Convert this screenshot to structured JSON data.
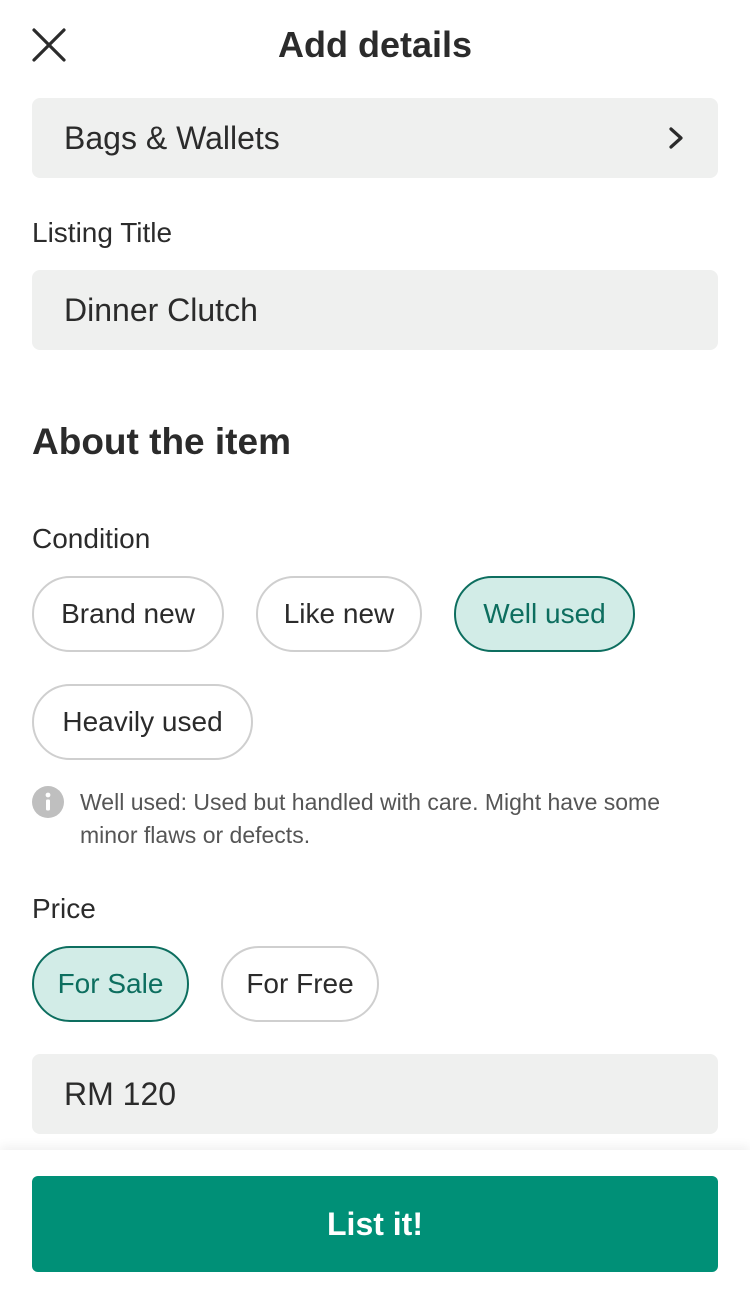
{
  "header": {
    "title": "Add details",
    "close_icon": "close-icon"
  },
  "category": {
    "value": "Bags & Wallets",
    "icon": "chevron-right-icon"
  },
  "listing_title": {
    "label": "Listing Title",
    "value": "Dinner Clutch"
  },
  "about": {
    "title": "About the item"
  },
  "condition": {
    "label": "Condition",
    "options": [
      {
        "label": "Brand new",
        "selected": false
      },
      {
        "label": "Like new",
        "selected": false
      },
      {
        "label": "Well used",
        "selected": true
      },
      {
        "label": "Heavily used",
        "selected": false
      }
    ],
    "hint": "Well used: Used but handled with care. Might have some minor flaws or defects.",
    "hint_icon": "info-icon"
  },
  "price": {
    "label": "Price",
    "options": [
      {
        "label": "For Sale",
        "selected": true
      },
      {
        "label": "For Free",
        "selected": false
      }
    ],
    "value": "RM 120"
  },
  "footer": {
    "submit_label": "List it!"
  },
  "colors": {
    "accent": "#009077",
    "selected_chip_bg": "#d2ece7",
    "selected_chip_text": "#0d6e5f",
    "field_bg": "#eff0ef"
  }
}
